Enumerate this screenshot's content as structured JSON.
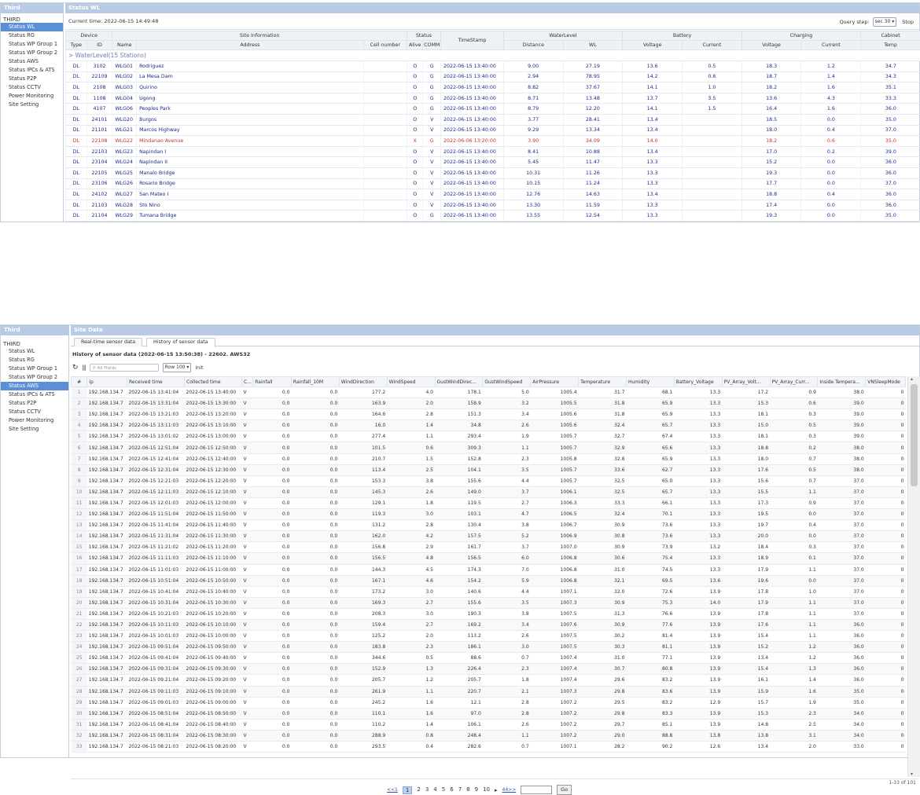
{
  "top": {
    "sidebar_title": "Third",
    "main_title": "Status WL",
    "root": "THIRD",
    "menu": [
      "Status WL",
      "Status RG",
      "Status WP Group 1",
      "Status WP Group 2",
      "Status AWS",
      "Status IPCs & ATS",
      "Status P2P",
      "Status CCTV",
      "Power Monitoring",
      "Site Setting"
    ],
    "current_time": "Current time: 2022-06-15 14:49:48",
    "query_step_label": "Query step:",
    "query_step_value": "sec 30 ▾",
    "stop_label": "Stop",
    "group_headers": [
      "Device",
      "Site Information",
      "Status",
      "TimeStamp",
      "WaterLevel",
      "Battery",
      "Charging",
      "Cabinet"
    ],
    "sub_headers": [
      "Type",
      "ID",
      "Name",
      "Address",
      "Cell number",
      "Alive",
      "COMM",
      "Distance",
      "WL",
      "Voltage",
      "Current",
      "Voltage",
      "Current",
      "Temp"
    ],
    "group_row": "> WaterLevel(15 Stations)",
    "rows": [
      {
        "type": "DL",
        "id": "3102",
        "name": "WLG01",
        "addr": "Rodriguez",
        "alive": "O",
        "comm": "G",
        "ts": "2022-06-15 13:40:00",
        "dist": "9.00",
        "wl": "27.19",
        "bv": "13.6",
        "bc": "0.5",
        "cv": "18.3",
        "cc": "1.2",
        "temp": "34.7",
        "err": false
      },
      {
        "type": "DL",
        "id": "22109",
        "name": "WLG02",
        "addr": "La Mesa Dam",
        "alive": "O",
        "comm": "G",
        "ts": "2022-06-15 13:40:00",
        "dist": "2.94",
        "wl": "78.95",
        "bv": "14.2",
        "bc": "0.6",
        "cv": "18.7",
        "cc": "1.4",
        "temp": "34.3",
        "err": false
      },
      {
        "type": "DL",
        "id": "2108",
        "name": "WLG03",
        "addr": "Quirino",
        "alive": "O",
        "comm": "G",
        "ts": "2022-06-15 13:40:00",
        "dist": "8.82",
        "wl": "37.67",
        "bv": "14.1",
        "bc": "1.0",
        "cv": "18.2",
        "cc": "1.6",
        "temp": "35.1",
        "err": false
      },
      {
        "type": "DL",
        "id": "1108",
        "name": "WLG04",
        "addr": "Ugong",
        "alive": "O",
        "comm": "G",
        "ts": "2022-06-15 13:40:00",
        "dist": "8.71",
        "wl": "13.48",
        "bv": "13.7",
        "bc": "3.5",
        "cv": "13.6",
        "cc": "4.3",
        "temp": "33.3",
        "err": false
      },
      {
        "type": "DL",
        "id": "4107",
        "name": "WLG06",
        "addr": "Peoples Park",
        "alive": "O",
        "comm": "G",
        "ts": "2022-06-15 13:40:00",
        "dist": "8.79",
        "wl": "12.20",
        "bv": "14.1",
        "bc": "1.5",
        "cv": "16.4",
        "cc": "1.6",
        "temp": "36.0",
        "err": false
      },
      {
        "type": "DL",
        "id": "24101",
        "name": "WLG20",
        "addr": "Burgos",
        "alive": "O",
        "comm": "V",
        "ts": "2022-06-15 13:40:00",
        "dist": "3.77",
        "wl": "28.41",
        "bv": "13.4",
        "bc": "",
        "cv": "18.5",
        "cc": "0.0",
        "temp": "35.0",
        "err": false
      },
      {
        "type": "DL",
        "id": "21101",
        "name": "WLG21",
        "addr": "Marcos Highway",
        "alive": "O",
        "comm": "V",
        "ts": "2022-06-15 13:40:00",
        "dist": "9.29",
        "wl": "13.34",
        "bv": "13.4",
        "bc": "",
        "cv": "18.0",
        "cc": "0.4",
        "temp": "37.0",
        "err": false
      },
      {
        "type": "DL",
        "id": "22108",
        "name": "WLG22",
        "addr": "Mindanao Avenue",
        "alive": "X",
        "comm": "G",
        "ts": "2022-06-06 13:20:00",
        "dist": "3.90",
        "wl": "34.09",
        "bv": "14.0",
        "bc": "",
        "cv": "18.2",
        "cc": "0.6",
        "temp": "35.0",
        "err": true
      },
      {
        "type": "DL",
        "id": "22103",
        "name": "WLG23",
        "addr": "Napindan I",
        "alive": "O",
        "comm": "V",
        "ts": "2022-06-15 13:40:00",
        "dist": "8.41",
        "wl": "10.88",
        "bv": "13.4",
        "bc": "",
        "cv": "17.0",
        "cc": "0.2",
        "temp": "39.0",
        "err": false
      },
      {
        "type": "DL",
        "id": "23104",
        "name": "WLG24",
        "addr": "Napindan II",
        "alive": "O",
        "comm": "V",
        "ts": "2022-06-15 13:40:00",
        "dist": "5.45",
        "wl": "11.47",
        "bv": "13.3",
        "bc": "",
        "cv": "15.2",
        "cc": "0.0",
        "temp": "36.0",
        "err": false
      },
      {
        "type": "DL",
        "id": "22105",
        "name": "WLG25",
        "addr": "Manalo Bridge",
        "alive": "O",
        "comm": "V",
        "ts": "2022-06-15 13:40:00",
        "dist": "10.31",
        "wl": "11.26",
        "bv": "13.3",
        "bc": "",
        "cv": "19.3",
        "cc": "0.0",
        "temp": "36.0",
        "err": false
      },
      {
        "type": "DL",
        "id": "23106",
        "name": "WLG26",
        "addr": "Rosario Bridge",
        "alive": "O",
        "comm": "V",
        "ts": "2022-06-15 13:40:00",
        "dist": "10.15",
        "wl": "11.24",
        "bv": "13.3",
        "bc": "",
        "cv": "17.7",
        "cc": "0.0",
        "temp": "37.0",
        "err": false
      },
      {
        "type": "DL",
        "id": "24102",
        "name": "WLG27",
        "addr": "San Mateo I",
        "alive": "O",
        "comm": "V",
        "ts": "2022-06-15 13:40:00",
        "dist": "12.76",
        "wl": "14.63",
        "bv": "13.4",
        "bc": "",
        "cv": "18.8",
        "cc": "0.4",
        "temp": "36.0",
        "err": false
      },
      {
        "type": "DL",
        "id": "21103",
        "name": "WLG28",
        "addr": "Sto Nino",
        "alive": "O",
        "comm": "V",
        "ts": "2022-06-15 13:40:00",
        "dist": "13.30",
        "wl": "11.59",
        "bv": "13.3",
        "bc": "",
        "cv": "17.4",
        "cc": "0.0",
        "temp": "36.0",
        "err": false
      },
      {
        "type": "DL",
        "id": "21104",
        "name": "WLG29",
        "addr": "Tumana Bridge",
        "alive": "O",
        "comm": "G",
        "ts": "2022-06-15 13:40:00",
        "dist": "13.55",
        "wl": "12.54",
        "bv": "13.3",
        "bc": "",
        "cv": "19.3",
        "cc": "0.0",
        "temp": "35.0",
        "err": false
      }
    ]
  },
  "bottom": {
    "sidebar_title": "Third",
    "main_title": "Site Data",
    "root": "THIRD",
    "menu": [
      "Status WL",
      "Status RG",
      "Status WP Group 1",
      "Status WP Group 2",
      "Status AWS",
      "Status IPCs & ATS",
      "Status P2P",
      "Status CCTV",
      "Power Monitoring",
      "Site Setting"
    ],
    "tabs": [
      "Real-time sensor data",
      "History of sensor data"
    ],
    "history_title": "History of sensor data (2022-06-15 13:50:38) - 22602. AWS32",
    "search_placeholder": "All Fields",
    "row_size": "Row 100 ▾",
    "init_label": "Init",
    "columns": [
      "#",
      "ip",
      "Received time",
      "Collected time",
      "C...",
      "Rainfall",
      "Rainfall_10M",
      "WindDirection",
      "WindSpeed",
      "GustWindDirec...",
      "GustWindSpeed",
      "AirPressure",
      "Temperature",
      "Humidity",
      "Battery_Voltage",
      "PV_Array_Volt...",
      "PV_Array_Curr...",
      "Inside Tempera...",
      "VNSleepMode"
    ],
    "rows": [
      [
        "1",
        "192.168.134.7",
        "2022-06-15 13:41:04",
        "2022-06-15 13:40:00",
        "V",
        "0.0",
        "0.0",
        "177.2",
        "4.0",
        "178.1",
        "5.0",
        "1005.4",
        "31.7",
        "68.1",
        "13.3",
        "17.2",
        "0.9",
        "38.0",
        "0"
      ],
      [
        "2",
        "192.168.134.7",
        "2022-06-15 13:31:04",
        "2022-06-15 13:30:00",
        "V",
        "0.0",
        "0.0",
        "163.9",
        "2.0",
        "158.9",
        "3.2",
        "1005.5",
        "31.8",
        "65.9",
        "13.3",
        "15.3",
        "0.6",
        "39.0",
        "0"
      ],
      [
        "3",
        "192.168.134.7",
        "2022-06-15 13:21:03",
        "2022-06-15 13:20:00",
        "V",
        "0.0",
        "0.0",
        "164.6",
        "2.8",
        "151.3",
        "3.4",
        "1005.6",
        "31.8",
        "65.9",
        "13.3",
        "18.1",
        "0.3",
        "39.0",
        "0"
      ],
      [
        "4",
        "192.168.134.7",
        "2022-06-15 13:11:03",
        "2022-06-15 13:10:00",
        "V",
        "0.0",
        "0.0",
        "16.0",
        "1.4",
        "34.8",
        "2.6",
        "1005.6",
        "32.4",
        "65.7",
        "13.3",
        "15.0",
        "0.5",
        "39.0",
        "0"
      ],
      [
        "5",
        "192.168.134.7",
        "2022-06-15 13:01:02",
        "2022-06-15 13:00:00",
        "V",
        "0.0",
        "0.0",
        "277.4",
        "1.1",
        "293.4",
        "1.9",
        "1005.7",
        "32.7",
        "67.4",
        "13.3",
        "18.1",
        "0.3",
        "39.0",
        "0"
      ],
      [
        "6",
        "192.168.134.7",
        "2022-06-15 12:51:04",
        "2022-06-15 12:50:00",
        "V",
        "0.0",
        "0.0",
        "101.5",
        "0.6",
        "309.3",
        "1.1",
        "1005.7",
        "32.9",
        "65.6",
        "13.3",
        "18.8",
        "0.2",
        "38.0",
        "0"
      ],
      [
        "7",
        "192.168.134.7",
        "2022-06-15 12:41:04",
        "2022-06-15 12:40:00",
        "V",
        "0.0",
        "0.0",
        "210.7",
        "1.5",
        "152.8",
        "2.3",
        "1005.8",
        "32.8",
        "65.9",
        "13.3",
        "18.0",
        "0.7",
        "38.0",
        "0"
      ],
      [
        "8",
        "192.168.134.7",
        "2022-06-15 12:31:04",
        "2022-06-15 12:30:00",
        "V",
        "0.0",
        "0.0",
        "113.4",
        "2.5",
        "104.1",
        "3.5",
        "1005.7",
        "33.6",
        "62.7",
        "13.3",
        "17.6",
        "0.5",
        "38.0",
        "0"
      ],
      [
        "9",
        "192.168.134.7",
        "2022-06-15 12:21:03",
        "2022-06-15 12:20:00",
        "V",
        "0.0",
        "0.0",
        "153.3",
        "3.8",
        "155.6",
        "4.4",
        "1005.7",
        "32.5",
        "65.0",
        "13.3",
        "15.6",
        "0.7",
        "37.0",
        "0"
      ],
      [
        "10",
        "192.168.134.7",
        "2022-06-15 12:11:03",
        "2022-06-15 12:10:00",
        "V",
        "0.0",
        "0.0",
        "145.3",
        "2.6",
        "149.0",
        "3.7",
        "1006.1",
        "32.5",
        "65.7",
        "13.3",
        "15.5",
        "1.1",
        "37.0",
        "0"
      ],
      [
        "11",
        "192.168.134.7",
        "2022-06-15 12:01:03",
        "2022-06-15 12:00:00",
        "V",
        "0.0",
        "0.0",
        "129.1",
        "1.8",
        "119.5",
        "2.7",
        "1006.3",
        "33.3",
        "66.1",
        "13.3",
        "17.3",
        "0.9",
        "37.0",
        "0"
      ],
      [
        "12",
        "192.168.134.7",
        "2022-06-15 11:51:04",
        "2022-06-15 11:50:00",
        "V",
        "0.0",
        "0.0",
        "119.3",
        "3.0",
        "103.1",
        "4.7",
        "1006.5",
        "32.4",
        "70.1",
        "13.3",
        "19.5",
        "0.0",
        "37.0",
        "0"
      ],
      [
        "13",
        "192.168.134.7",
        "2022-06-15 11:41:04",
        "2022-06-15 11:40:00",
        "V",
        "0.0",
        "0.0",
        "131.2",
        "2.8",
        "130.4",
        "3.8",
        "1006.7",
        "30.9",
        "73.6",
        "13.3",
        "19.7",
        "0.4",
        "37.0",
        "0"
      ],
      [
        "14",
        "192.168.134.7",
        "2022-06-15 11:31:04",
        "2022-06-15 11:30:00",
        "V",
        "0.0",
        "0.0",
        "162.0",
        "4.2",
        "157.5",
        "5.2",
        "1006.9",
        "30.8",
        "73.6",
        "13.3",
        "20.0",
        "0.0",
        "37.0",
        "0"
      ],
      [
        "15",
        "192.168.134.7",
        "2022-06-15 11:21:02",
        "2022-06-15 11:20:00",
        "V",
        "0.0",
        "0.0",
        "156.8",
        "2.9",
        "161.7",
        "3.7",
        "1007.0",
        "30.9",
        "73.9",
        "13.2",
        "18.4",
        "0.3",
        "37.0",
        "0"
      ],
      [
        "16",
        "192.168.134.7",
        "2022-06-15 11:11:03",
        "2022-06-15 11:10:00",
        "V",
        "0.0",
        "0.0",
        "156.5",
        "4.8",
        "156.5",
        "6.0",
        "1006.8",
        "30.6",
        "75.4",
        "13.3",
        "18.9",
        "0.1",
        "37.0",
        "0"
      ],
      [
        "17",
        "192.168.134.7",
        "2022-06-15 11:01:03",
        "2022-06-15 11:00:00",
        "V",
        "0.0",
        "0.0",
        "144.3",
        "4.5",
        "174.3",
        "7.0",
        "1006.8",
        "31.0",
        "74.5",
        "13.3",
        "17.9",
        "1.1",
        "37.0",
        "0"
      ],
      [
        "18",
        "192.168.134.7",
        "2022-06-15 10:51:04",
        "2022-06-15 10:50:00",
        "V",
        "0.0",
        "0.0",
        "167.1",
        "4.6",
        "154.2",
        "5.9",
        "1006.8",
        "32.1",
        "69.5",
        "13.6",
        "19.6",
        "0.0",
        "37.0",
        "0"
      ],
      [
        "19",
        "192.168.134.7",
        "2022-06-15 10:41:04",
        "2022-06-15 10:40:00",
        "V",
        "0.0",
        "0.0",
        "173.2",
        "3.0",
        "140.6",
        "4.4",
        "1007.1",
        "32.0",
        "72.6",
        "13.9",
        "17.8",
        "1.0",
        "37.0",
        "0"
      ],
      [
        "20",
        "192.168.134.7",
        "2022-06-15 10:31:04",
        "2022-06-15 10:30:00",
        "V",
        "0.0",
        "0.0",
        "169.3",
        "2.7",
        "155.6",
        "3.5",
        "1007.3",
        "30.9",
        "75.3",
        "14.0",
        "17.9",
        "1.1",
        "37.0",
        "0"
      ],
      [
        "21",
        "192.168.134.7",
        "2022-06-15 10:21:03",
        "2022-06-15 10:20:00",
        "V",
        "0.0",
        "0.0",
        "208.3",
        "3.0",
        "190.3",
        "3.8",
        "1007.5",
        "31.3",
        "76.6",
        "13.9",
        "17.8",
        "1.1",
        "37.0",
        "0"
      ],
      [
        "22",
        "192.168.134.7",
        "2022-06-15 10:11:03",
        "2022-06-15 10:10:00",
        "V",
        "0.0",
        "0.0",
        "159.4",
        "2.7",
        "169.2",
        "3.4",
        "1007.6",
        "30.9",
        "77.6",
        "13.9",
        "17.6",
        "1.1",
        "36.0",
        "0"
      ],
      [
        "23",
        "192.168.134.7",
        "2022-06-15 10:01:03",
        "2022-06-15 10:00:00",
        "V",
        "0.0",
        "0.0",
        "125.2",
        "2.0",
        "113.2",
        "2.6",
        "1007.5",
        "30.2",
        "81.4",
        "13.9",
        "15.4",
        "1.1",
        "36.0",
        "0"
      ],
      [
        "24",
        "192.168.134.7",
        "2022-06-15 09:51:04",
        "2022-06-15 09:50:00",
        "V",
        "0.0",
        "0.0",
        "183.8",
        "2.3",
        "186.1",
        "3.0",
        "1007.5",
        "30.3",
        "81.1",
        "13.9",
        "15.2",
        "1.2",
        "36.0",
        "0"
      ],
      [
        "25",
        "192.168.134.7",
        "2022-06-15 09:41:04",
        "2022-06-15 09:40:00",
        "V",
        "0.0",
        "0.0",
        "344.6",
        "0.5",
        "88.6",
        "0.7",
        "1007.4",
        "31.0",
        "77.1",
        "13.9",
        "13.4",
        "1.2",
        "36.0",
        "0"
      ],
      [
        "26",
        "192.168.134.7",
        "2022-06-15 09:31:04",
        "2022-06-15 09:30:00",
        "V",
        "0.0",
        "0.0",
        "152.9",
        "1.3",
        "226.4",
        "2.3",
        "1007.4",
        "30.7",
        "80.8",
        "13.9",
        "15.4",
        "1.3",
        "36.0",
        "0"
      ],
      [
        "27",
        "192.168.134.7",
        "2022-06-15 09:21:04",
        "2022-06-15 09:20:00",
        "V",
        "0.0",
        "0.0",
        "205.7",
        "1.2",
        "205.7",
        "1.8",
        "1007.4",
        "29.6",
        "83.2",
        "13.9",
        "16.1",
        "1.4",
        "36.0",
        "0"
      ],
      [
        "28",
        "192.168.134.7",
        "2022-06-15 09:11:03",
        "2022-06-15 09:10:00",
        "V",
        "0.0",
        "0.0",
        "261.9",
        "1.1",
        "220.7",
        "2.1",
        "1007.3",
        "29.8",
        "83.6",
        "13.9",
        "15.9",
        "1.6",
        "35.0",
        "0"
      ],
      [
        "29",
        "192.168.134.7",
        "2022-06-15 09:01:03",
        "2022-06-15 09:00:00",
        "V",
        "0.0",
        "0.0",
        "245.2",
        "1.6",
        "12.1",
        "2.8",
        "1007.2",
        "29.5",
        "83.2",
        "12.9",
        "15.7",
        "1.9",
        "35.0",
        "0"
      ],
      [
        "30",
        "192.168.134.7",
        "2022-06-15 08:51:04",
        "2022-06-15 08:50:00",
        "V",
        "0.0",
        "0.0",
        "110.1",
        "1.6",
        "97.0",
        "2.8",
        "1007.2",
        "29.8",
        "83.3",
        "13.9",
        "15.3",
        "2.3",
        "34.0",
        "0"
      ],
      [
        "31",
        "192.168.134.7",
        "2022-06-15 08:41:04",
        "2022-06-15 08:40:00",
        "V",
        "0.0",
        "0.0",
        "110.2",
        "1.4",
        "106.1",
        "2.6",
        "1007.2",
        "29.7",
        "85.1",
        "13.9",
        "14.8",
        "2.5",
        "34.0",
        "0"
      ],
      [
        "32",
        "192.168.134.7",
        "2022-06-15 08:31:04",
        "2022-06-15 08:30:00",
        "V",
        "0.0",
        "0.0",
        "288.9",
        "0.8",
        "248.4",
        "1.1",
        "1007.2",
        "29.0",
        "88.8",
        "13.8",
        "13.8",
        "3.1",
        "34.0",
        "0"
      ],
      [
        "33",
        "192.168.134.7",
        "2022-06-15 08:21:03",
        "2022-06-15 08:20:00",
        "V",
        "0.0",
        "0.0",
        "293.5",
        "0.4",
        "282.6",
        "0.7",
        "1007.1",
        "28.2",
        "90.2",
        "12.6",
        "13.4",
        "2.0",
        "33.0",
        "0"
      ]
    ],
    "pager_first": "<<1",
    "pages": [
      "1",
      "2",
      "3",
      "4",
      "5",
      "6",
      "7",
      "8",
      "9",
      "10"
    ],
    "pager_next": "▸",
    "pager_last": "44>>",
    "go_label": "Go",
    "range_info": "1-33 of 101"
  }
}
